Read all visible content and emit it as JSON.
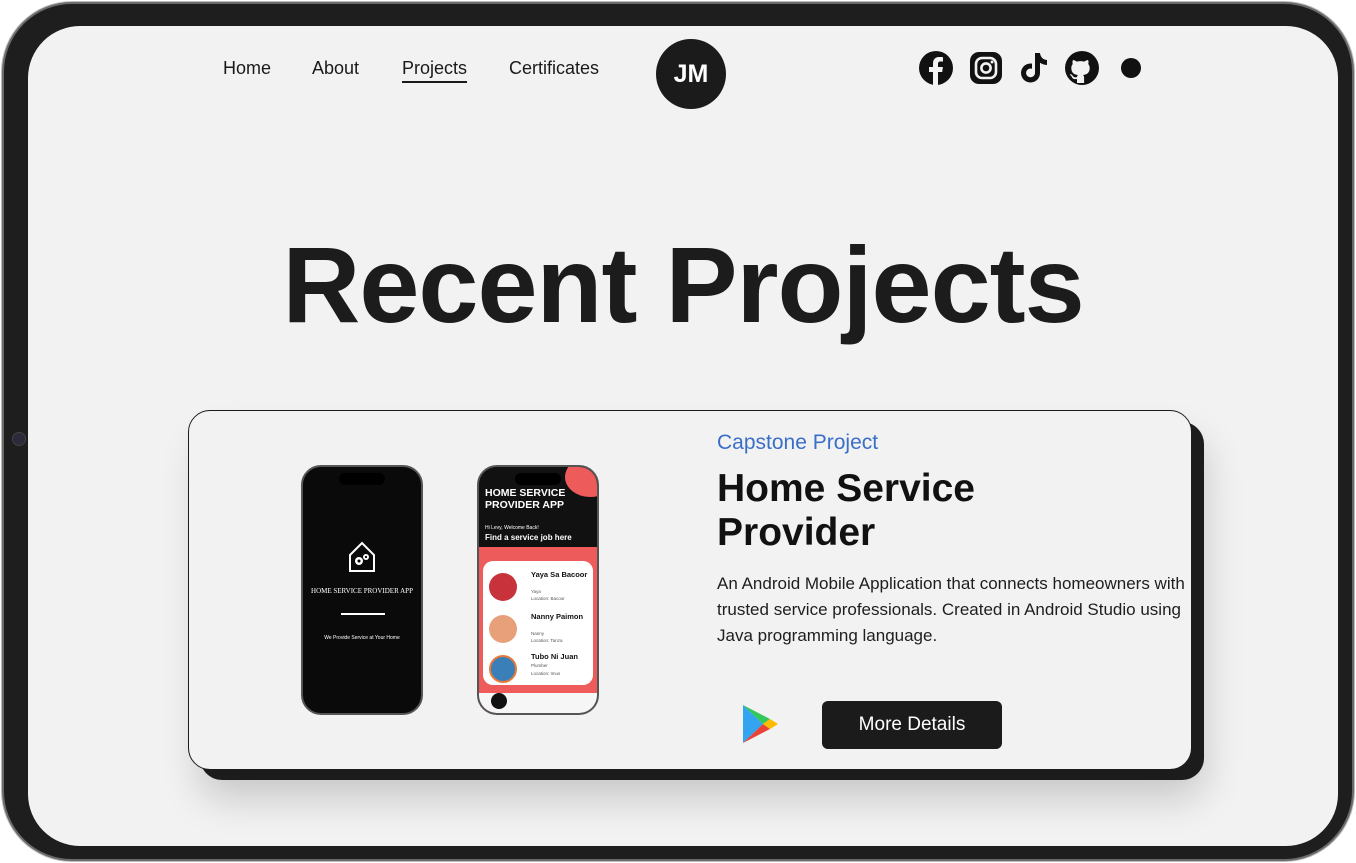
{
  "nav": {
    "items": [
      {
        "label": "Home"
      },
      {
        "label": "About"
      },
      {
        "label": "Projects"
      },
      {
        "label": "Certificates"
      }
    ],
    "logo": "JM",
    "social": [
      "facebook-icon",
      "instagram-icon",
      "tiktok-icon",
      "github-icon"
    ]
  },
  "hero": {
    "title": "Recent Projects"
  },
  "project": {
    "subtitle": "Capstone Project",
    "title": "Home Service Provider",
    "description": "An Android Mobile Application that connects homeowners with trusted service professionals. Created in Android Studio using Java programming language.",
    "store_icon": "google-play-icon",
    "button": "More Details",
    "phone1": {
      "title": "HOME SERVICE PROVIDER APP",
      "tagline": "We Provide Service at Your Home"
    },
    "phone2": {
      "title": "HOME SERVICE PROVIDER APP",
      "welcome": "Hi Levy, Welcome Back!",
      "heading": "Find a service job here",
      "items": [
        {
          "name": "Yaya Sa Bacoor",
          "role": "Yaya",
          "location": "Location: Bacoor"
        },
        {
          "name": "Nanny Paimon",
          "role": "Nanny",
          "location": "Location: Tanza"
        },
        {
          "name": "Tubo Ni Juan",
          "role": "Plumber",
          "location": "Location: Imus"
        }
      ]
    }
  },
  "colors": {
    "accent": "#3a6fc9",
    "dark": "#1b1b1b",
    "background": "#f2f2f2",
    "app_red": "#ee5b5b"
  }
}
